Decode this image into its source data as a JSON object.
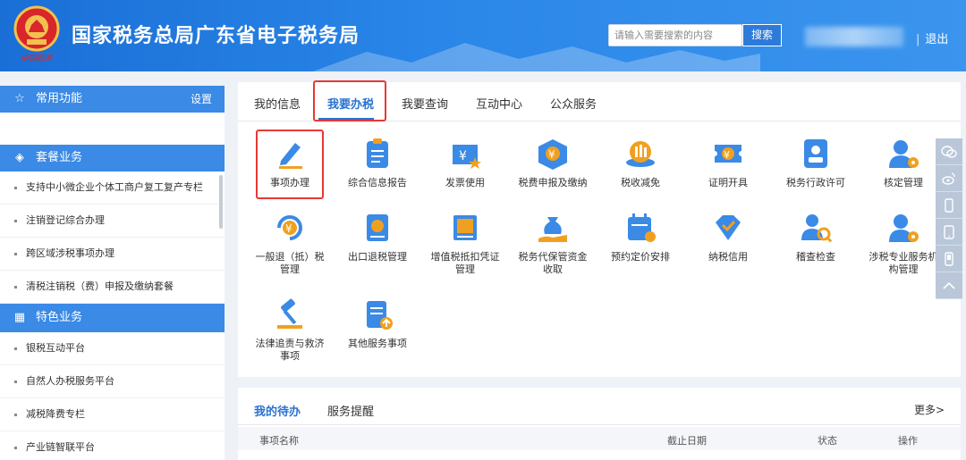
{
  "header": {
    "title": "国家税务总局广东省电子税务局",
    "emblem_sub": "中国税务",
    "search_placeholder": "请输入需要搜索的内容",
    "search_button": "搜索",
    "logout": "退出",
    "separator": "|"
  },
  "sidebar": {
    "common": {
      "label": "常用功能",
      "settings": "设置"
    },
    "package": {
      "label": "套餐业务"
    },
    "package_items": [
      "支持中小微企业个体工商户复工复产专栏",
      "注销登记综合办理",
      "跨区域涉税事项办理",
      "清税注销税（费）申报及缴纳套餐"
    ],
    "special": {
      "label": "特色业务"
    },
    "special_items": [
      "银税互动平台",
      "自然人办税服务平台",
      "减税降费专栏",
      "产业链智联平台"
    ]
  },
  "tabs": [
    "我的信息",
    "我要办税",
    "我要查询",
    "互动中心",
    "公众服务"
  ],
  "active_tab": "我要办税",
  "services": [
    {
      "label": "事项办理",
      "icon": "pencil-icon"
    },
    {
      "label": "综合信息报告",
      "icon": "clipboard-icon"
    },
    {
      "label": "发票使用",
      "icon": "invoice-icon"
    },
    {
      "label": "税费申报及缴纳",
      "icon": "tax-box-icon"
    },
    {
      "label": "税收减免",
      "icon": "coin-stack-icon"
    },
    {
      "label": "证明开具",
      "icon": "ticket-icon"
    },
    {
      "label": "税务行政许可",
      "icon": "id-card-icon"
    },
    {
      "label": "核定管理",
      "icon": "user-gear-icon"
    },
    {
      "label": "一般退（抵）税管理",
      "icon": "refund-icon"
    },
    {
      "label": "出口退税管理",
      "icon": "export-book-icon"
    },
    {
      "label": "增值税抵扣凭证管理",
      "icon": "vat-voucher-icon"
    },
    {
      "label": "税务代保管资金收取",
      "icon": "money-bag-hand-icon"
    },
    {
      "label": "预约定价安排",
      "icon": "calendar-icon"
    },
    {
      "label": "纳税信用",
      "icon": "diamond-check-icon"
    },
    {
      "label": "稽查检查",
      "icon": "inspector-icon"
    },
    {
      "label": "涉税专业服务机构管理",
      "icon": "user-gear-icon"
    },
    {
      "label": "法律追责与救济事项",
      "icon": "gavel-icon"
    },
    {
      "label": "其他服务事项",
      "icon": "doc-upload-icon"
    }
  ],
  "todo": {
    "tabs": [
      "我的待办",
      "服务提醒"
    ],
    "more": "更多>",
    "columns": [
      "事项名称",
      "截止日期",
      "状态",
      "操作"
    ]
  },
  "colors": {
    "header": "#2a86e8",
    "accent": "#2b72cf",
    "highlight": "#e53935",
    "sidebar_head": "#3a8ae6"
  }
}
